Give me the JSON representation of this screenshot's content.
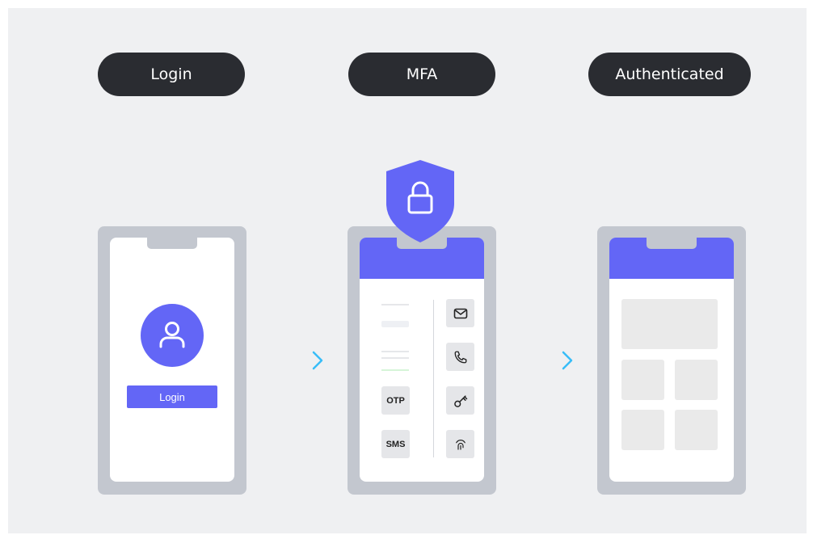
{
  "steps": {
    "login": "Login",
    "mfa": "MFA",
    "authenticated": "Authenticated"
  },
  "login_screen": {
    "button_label": "Login"
  },
  "mfa_screen": {
    "otp_label": "OTP",
    "sms_label": "SMS"
  },
  "icons": [
    "user-icon",
    "shield-lock-icon",
    "mail-icon",
    "phone-icon",
    "key-icon",
    "fingerprint-icon",
    "arrow-right-icon"
  ],
  "colors": {
    "accent": "#6366f6",
    "pill": "#2a2c31",
    "phone_frame": "#c3c7cf",
    "background": "#eff0f2",
    "arrow_start": "#6366f6",
    "arrow_end": "#38bdf8"
  }
}
